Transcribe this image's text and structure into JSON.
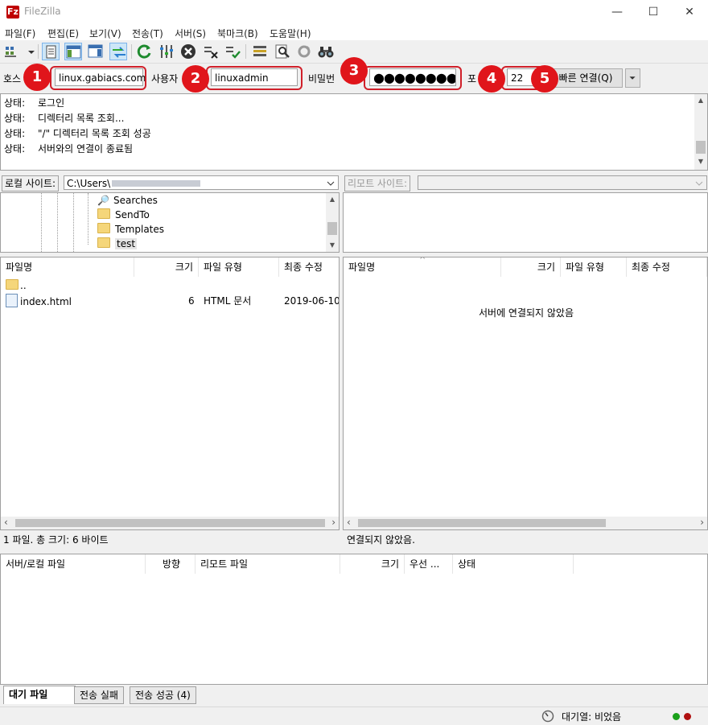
{
  "window": {
    "title": "FileZilla",
    "icon_letter": "Fz",
    "minimize": "—",
    "maximize": "☐",
    "close": "✕"
  },
  "menu": [
    "파일(F)",
    "편집(E)",
    "보기(V)",
    "전송(T)",
    "서버(S)",
    "북마크(B)",
    "도움말(H)"
  ],
  "quickconnect": {
    "host_label": "호스",
    "host_value": "linux.gabiacs.com",
    "user_label": "사용자",
    "user_value": "linuxadmin",
    "pass_label": "비밀번",
    "pass_value": "●●●●●●●●●",
    "port_label": "포",
    "port_value": "22",
    "connect_label": "빠른 연결(Q)",
    "badges": [
      "1",
      "2",
      "3",
      "4",
      "5"
    ]
  },
  "log": [
    {
      "k": "상태:",
      "v": "로그인"
    },
    {
      "k": "상태:",
      "v": "디렉터리 목록 조회..."
    },
    {
      "k": "상태:",
      "v": "\"/\" 디렉터리 목록 조회 성공"
    },
    {
      "k": "상태:",
      "v": "서버와의 연결이 종료됨"
    }
  ],
  "local": {
    "site_label": "로컬 사이트:",
    "path": "C:\\Users\\",
    "tree": [
      "Searches",
      "SendTo",
      "Templates",
      "test"
    ],
    "columns": [
      "파일명",
      "크기",
      "파일 유형",
      "최종 수정"
    ],
    "files": [
      {
        "name": "..",
        "size": "",
        "type": "",
        "modified": ""
      },
      {
        "name": "index.html",
        "size": "6",
        "type": "HTML 문서",
        "modified": "2019-06-10"
      }
    ],
    "status": "1 파일. 총 크기: 6 바이트"
  },
  "remote": {
    "site_label": "리모트 사이트:",
    "columns": [
      "파일명",
      "크기",
      "파일 유형",
      "최종 수정"
    ],
    "empty_message": "서버에 연결되지 않았음",
    "status": "연결되지 않았음."
  },
  "queue": {
    "columns": [
      "서버/로컬 파일",
      "방향",
      "리모트 파일",
      "크기",
      "우선 ...",
      "상태"
    ],
    "tabs": [
      "대기 파일",
      "전송 실패",
      "전송 성공 (4)"
    ]
  },
  "statusbar": {
    "queue_text": "대기열: 비었음"
  },
  "colors": {
    "accent_red": "#e0151b",
    "led_green": "#1aa01a",
    "led_red": "#b01010"
  }
}
